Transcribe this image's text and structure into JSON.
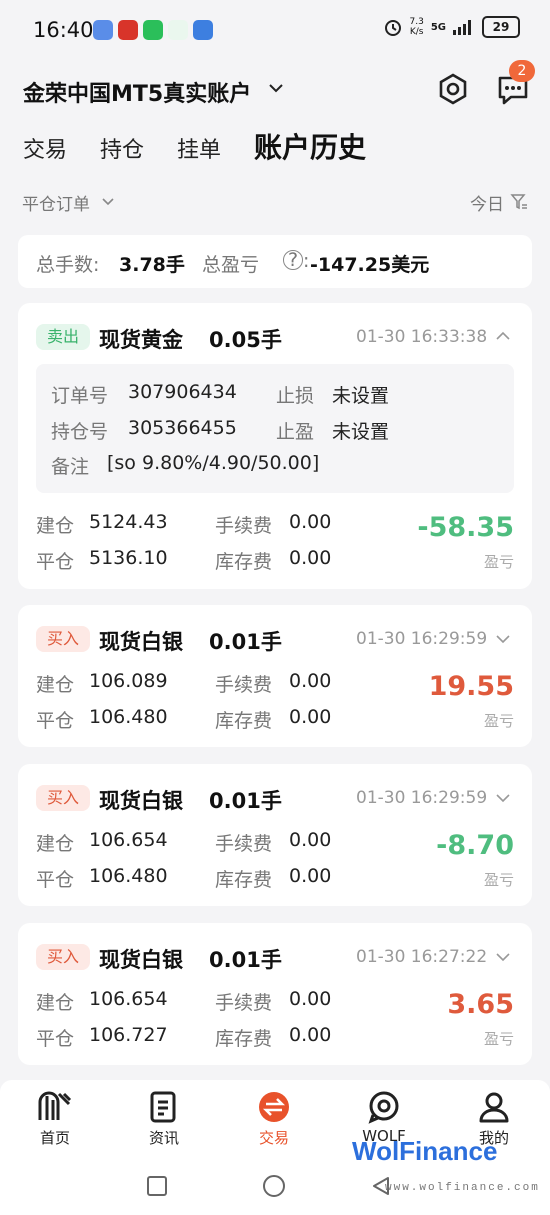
{
  "status_bar": {
    "time": "16:40",
    "net_speed_value": "7.3",
    "net_speed_unit": "K/s",
    "network": "5G",
    "battery": "29"
  },
  "header": {
    "account_title": "金荣中国MT5真实账户",
    "notification_count": "2"
  },
  "tabs": [
    {
      "label": "交易",
      "active": false
    },
    {
      "label": "持仓",
      "active": false
    },
    {
      "label": "挂单",
      "active": false
    },
    {
      "label": "账户历史",
      "active": true
    }
  ],
  "filters": {
    "order_type": "平仓订单",
    "date": "今日"
  },
  "summary": {
    "lots_label": "总手数:",
    "lots_value": "3.78手",
    "pl_label": "总盈亏",
    "pl_colon": ":",
    "pl_value": "-147.25美元"
  },
  "labels": {
    "open": "建仓",
    "close": "平仓",
    "commission": "手续费",
    "swap": "库存费",
    "pl": "盈亏",
    "order_no": "订单号",
    "position_no": "持仓号",
    "stop_loss": "止损",
    "take_profit": "止盈",
    "comment": "备注"
  },
  "orders": [
    {
      "side": "卖出",
      "symbol": "现货黄金",
      "lots": "0.05手",
      "time": "01-30 16:33:38",
      "expanded": true,
      "order_no": "307906434",
      "position_no": "305366455",
      "stop_loss": "未设置",
      "take_profit": "未设置",
      "comment": "[so 9.80%/4.90/50.00]",
      "open_price": "5124.43",
      "close_price": "5136.10",
      "commission": "0.00",
      "swap": "0.00",
      "profit": "-58.35"
    },
    {
      "side": "买入",
      "symbol": "现货白银",
      "lots": "0.01手",
      "time": "01-30 16:29:59",
      "expanded": false,
      "open_price": "106.089",
      "close_price": "106.480",
      "commission": "0.00",
      "swap": "0.00",
      "profit": "19.55"
    },
    {
      "side": "买入",
      "symbol": "现货白银",
      "lots": "0.01手",
      "time": "01-30 16:29:59",
      "expanded": false,
      "open_price": "106.654",
      "close_price": "106.480",
      "commission": "0.00",
      "swap": "0.00",
      "profit": "-8.70"
    },
    {
      "side": "买入",
      "symbol": "现货白银",
      "lots": "0.01手",
      "time": "01-30 16:27:22",
      "expanded": false,
      "open_price": "106.654",
      "close_price": "106.727",
      "commission": "0.00",
      "swap": "0.00",
      "profit": "3.65"
    }
  ],
  "bottom_nav": [
    {
      "label": "首页",
      "icon": "home-logo-icon",
      "active": false
    },
    {
      "label": "资讯",
      "icon": "news-icon",
      "active": false
    },
    {
      "label": "交易",
      "icon": "trade-icon",
      "active": true
    },
    {
      "label": "WOLF",
      "icon": "chat-bubble-icon",
      "active": false
    },
    {
      "label": "我的",
      "icon": "profile-icon",
      "active": false
    }
  ],
  "watermark": {
    "brand": "WolFinance",
    "url": "www.wolfinance.com"
  },
  "colors": {
    "accent": "#e8522b",
    "loss_green": "#4fbd7f",
    "profit_red": "#df5a3c",
    "badge": "#f0683a"
  }
}
